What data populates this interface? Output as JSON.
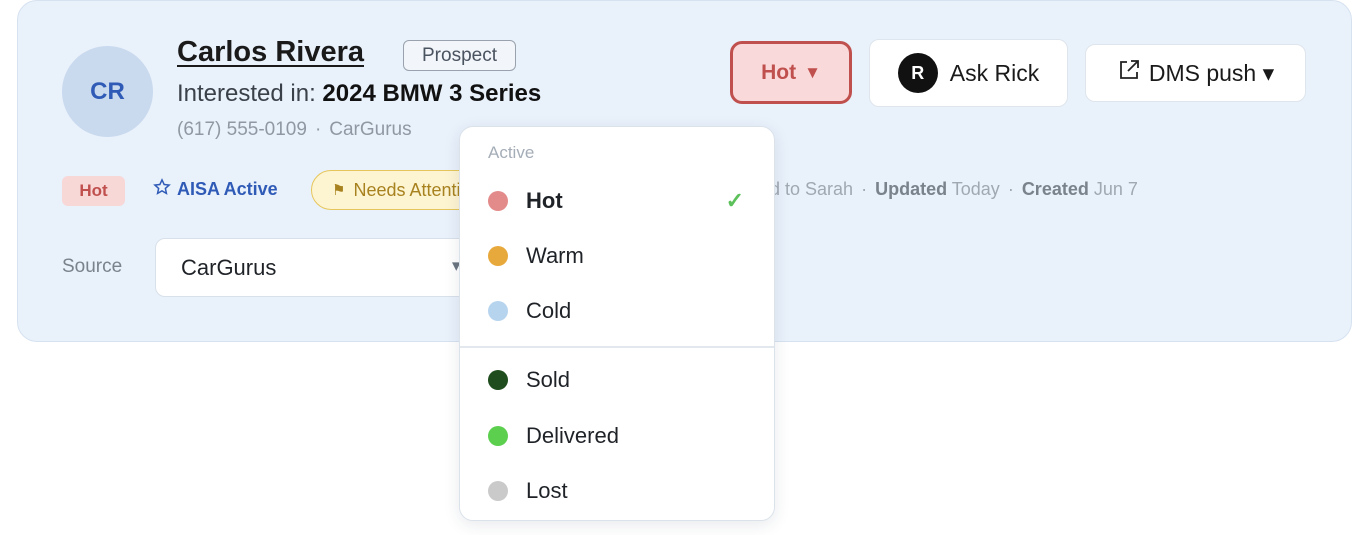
{
  "lead": {
    "initials": "CR",
    "name": "Carlos Rivera",
    "status_badge": "Prospect",
    "interested_label": "Interested in:",
    "vehicle": "2024 BMW 3 Series",
    "phone": "(617) 555-0109",
    "separator": "·",
    "lead_source": "CarGurus"
  },
  "actions": {
    "temperature_label": "Hot",
    "temperature_chevron": "▼",
    "ask_rick_avatar": "R",
    "ask_rick_label": "Ask Rick",
    "dms_label": "DMS push ▾"
  },
  "tags": {
    "hot": "Hot",
    "aisa": "AISA Active",
    "needs": "Needs Attention"
  },
  "meta": {
    "assigned": "ed to Sarah",
    "updated_label": "Updated",
    "updated_value": "Today",
    "created_label": "Created",
    "created_value": "Jun 7"
  },
  "source": {
    "label": "Source",
    "value": "CarGurus",
    "chevron": "▾"
  },
  "dropdown": {
    "section_label": "Active",
    "check": "✓",
    "items": [
      {
        "label": "Hot",
        "color": "#e38a8a",
        "selected": true
      },
      {
        "label": "Warm",
        "color": "#e8a93c"
      },
      {
        "label": "Cold",
        "color": "#b7d4ef"
      },
      {
        "label": "Sold",
        "color": "#1f4d1d"
      },
      {
        "label": "Delivered",
        "color": "#5ccf4f"
      },
      {
        "label": "Lost",
        "color": "#cacaca"
      }
    ]
  },
  "colors": {
    "card_bg": "#e9f1fb",
    "hot_red": "#c0504d",
    "link_blue": "#2f5bb7",
    "attention_gold": "#a8821e"
  }
}
